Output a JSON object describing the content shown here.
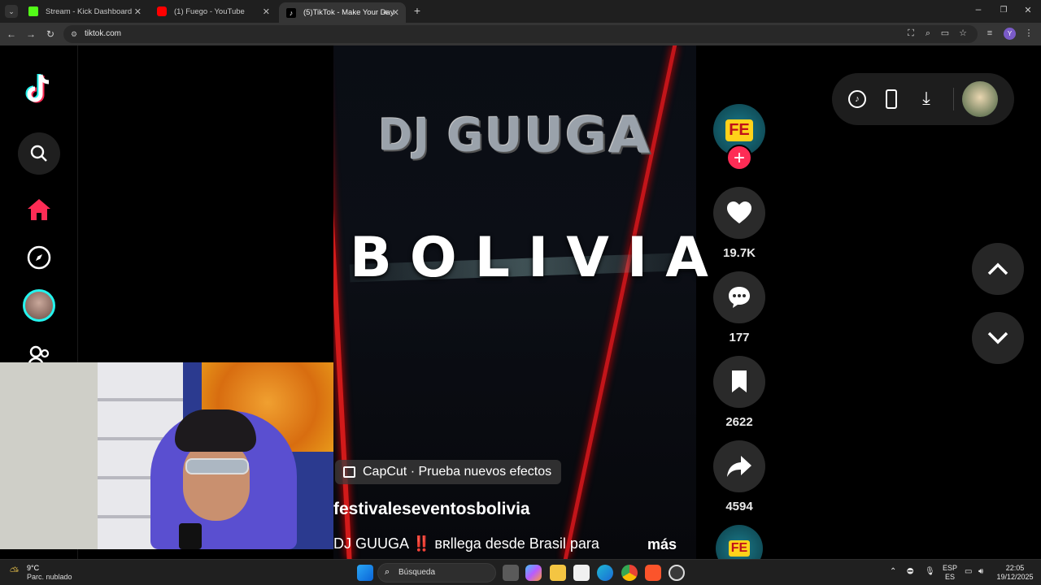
{
  "browser": {
    "tabs": [
      {
        "title": "Stream - Kick Dashboard",
        "favicon_color": "#53fc18"
      },
      {
        "title": "(1) Fuego - YouTube",
        "favicon_color": "#ff0000"
      },
      {
        "title": "(5)TikTok - Make Your Day",
        "favicon_color": "#ffffff"
      }
    ],
    "url": "tiktok.com",
    "profile_initial": "Y"
  },
  "video": {
    "overlay_title": "BOLIVIA",
    "logo_text": "DJ GUUGA",
    "effect_label": "CapCut · Prueba nuevos efectos",
    "author": "festivaleseventosbolivia",
    "description": "DJ GUUGA ‼️ ʙʀllega desde Brasil para",
    "more_label": "más"
  },
  "actions": {
    "likes": "19.7K",
    "comments": "177",
    "saves": "2622",
    "shares": "4594",
    "creator_badge": "FE"
  },
  "taskbar": {
    "weather_temp": "9°C",
    "weather_desc": "Parc. nublado",
    "search_label": "Búsqueda",
    "lang_top": "ESP",
    "lang_bottom": "ES",
    "time": "22:05",
    "date": "19/12/2025"
  },
  "colors": {
    "tiktok_red": "#fe2c55",
    "tiktok_cyan": "#25f4ee",
    "chrome_dark": "#1f1f1f",
    "action_bg": "#2a2a2a"
  }
}
